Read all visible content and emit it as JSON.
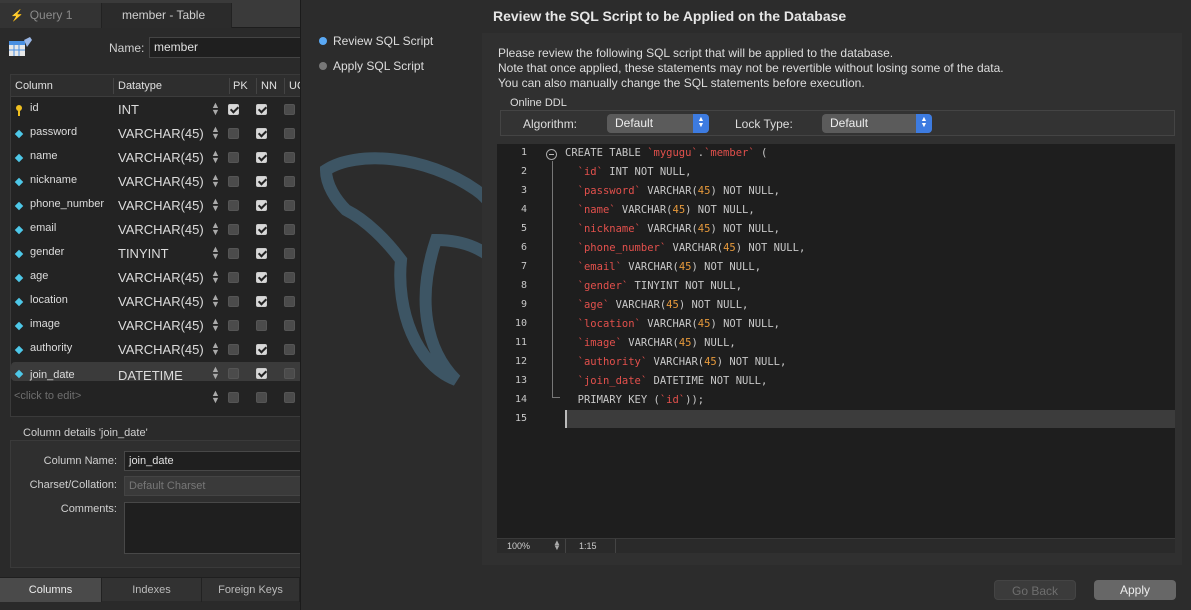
{
  "tabs": [
    {
      "label": "Query 1",
      "icon": "lightning-icon"
    },
    {
      "label": "member - Table"
    }
  ],
  "table_editor": {
    "name_label": "Name:",
    "name_value": "member",
    "columns_header": [
      "Column",
      "Datatype",
      "PK",
      "NN",
      "UQ"
    ],
    "rows": [
      {
        "name": "id",
        "type": "INT",
        "key": "primary",
        "pk": true,
        "nn": true
      },
      {
        "name": "password",
        "type": "VARCHAR(45)",
        "pk": false,
        "nn": true
      },
      {
        "name": "name",
        "type": "VARCHAR(45)",
        "pk": false,
        "nn": true
      },
      {
        "name": "nickname",
        "type": "VARCHAR(45)",
        "pk": false,
        "nn": true
      },
      {
        "name": "phone_number",
        "type": "VARCHAR(45)",
        "pk": false,
        "nn": true
      },
      {
        "name": "email",
        "type": "VARCHAR(45)",
        "pk": false,
        "nn": true
      },
      {
        "name": "gender",
        "type": "TINYINT",
        "pk": false,
        "nn": true
      },
      {
        "name": "age",
        "type": "VARCHAR(45)",
        "pk": false,
        "nn": true
      },
      {
        "name": "location",
        "type": "VARCHAR(45)",
        "pk": false,
        "nn": true
      },
      {
        "name": "image",
        "type": "VARCHAR(45)",
        "pk": false,
        "nn": false
      },
      {
        "name": "authority",
        "type": "VARCHAR(45)",
        "pk": false,
        "nn": true
      },
      {
        "name": "join_date",
        "type": "DATETIME",
        "pk": false,
        "nn": true,
        "selected": true
      }
    ],
    "placeholder_row": "<click to edit>",
    "details_title": "Column details 'join_date'",
    "details": {
      "column_name_label": "Column Name:",
      "column_name_value": "join_date",
      "charset_label": "Charset/Collation:",
      "charset_value": "Default Charset",
      "comments_label": "Comments:"
    },
    "bottom_tabs": [
      "Columns",
      "Indexes",
      "Foreign Keys"
    ]
  },
  "wizard": {
    "title": "Review the SQL Script to be Applied on the Database",
    "steps": [
      {
        "label": "Review SQL Script",
        "current": true
      },
      {
        "label": "Apply SQL Script",
        "current": false
      }
    ],
    "intro_lines": [
      "Please review the following SQL script that will be applied to the database.",
      "Note that once applied, these statements may not be revertible without losing some of the data.",
      "You can also manually change the SQL statements before execution."
    ],
    "online_ddl": {
      "label": "Online DDL",
      "algorithm_label": "Algorithm:",
      "algorithm_value": "Default",
      "lock_label": "Lock Type:",
      "lock_value": "Default"
    },
    "sql_lines": [
      "CREATE TABLE `mygugu`.`member` (",
      "  `id` INT NOT NULL,",
      "  `password` VARCHAR(45) NOT NULL,",
      "  `name` VARCHAR(45) NOT NULL,",
      "  `nickname` VARCHAR(45) NOT NULL,",
      "  `phone_number` VARCHAR(45) NOT NULL,",
      "  `email` VARCHAR(45) NOT NULL,",
      "  `gender` TINYINT NOT NULL,",
      "  `age` VARCHAR(45) NOT NULL,",
      "  `location` VARCHAR(45) NOT NULL,",
      "  `image` VARCHAR(45) NULL,",
      "  `authority` VARCHAR(45) NOT NULL,",
      "  `join_date` DATETIME NOT NULL,",
      "  PRIMARY KEY (`id`));",
      ""
    ],
    "zoom": "100%",
    "cursor_pos": "1:15",
    "back_label": "Go Back",
    "apply_label": "Apply"
  },
  "colors": {
    "accent": "#3d7be0",
    "backtick_identifier": "#e2504c",
    "number_literal": "#e79a3c",
    "column_icon": "#4ec8e8",
    "key_icon": "#f0c020"
  }
}
